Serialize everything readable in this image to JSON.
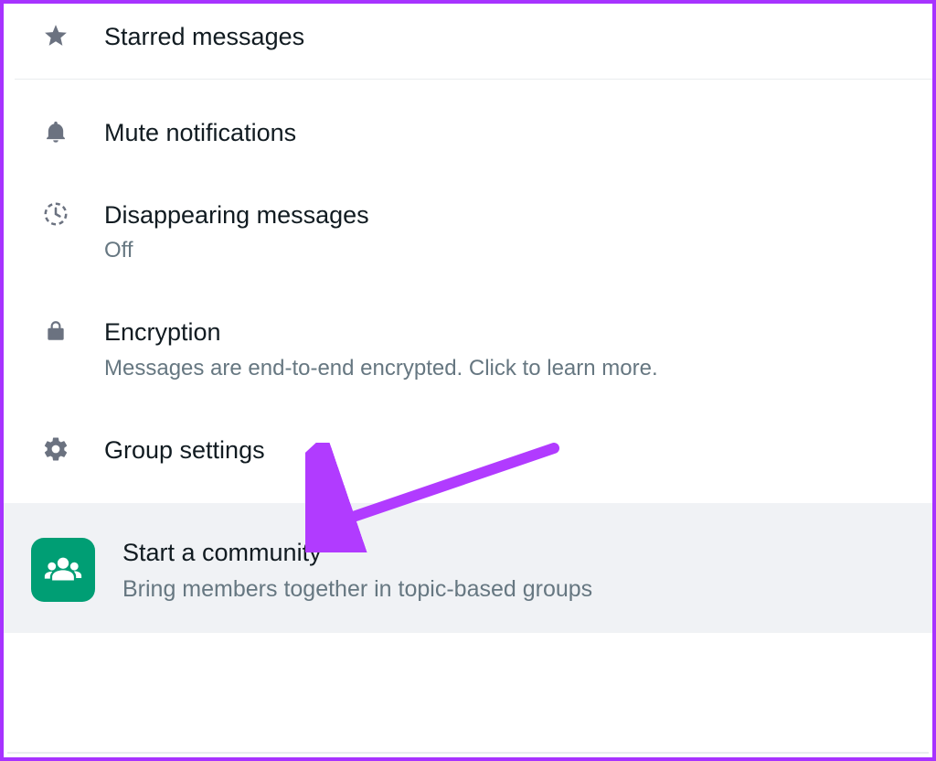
{
  "colors": {
    "frame_border": "#a733ff",
    "icon_muted": "#6b7280",
    "text_primary": "#111b21",
    "text_secondary": "#667781",
    "community_accent": "#009e74",
    "annotation_arrow": "#b13bff"
  },
  "rows": {
    "starred": {
      "label": "Starred messages",
      "icon": "star-icon"
    },
    "mute": {
      "label": "Mute notifications",
      "icon": "bell-icon"
    },
    "disappearing": {
      "label": "Disappearing messages",
      "value": "Off",
      "icon": "timer-icon"
    },
    "encryption": {
      "label": "Encryption",
      "description": "Messages are end-to-end encrypted. Click to learn more.",
      "icon": "lock-icon"
    },
    "group_settings": {
      "label": "Group settings",
      "icon": "gear-icon"
    }
  },
  "community": {
    "title": "Start a community",
    "subtitle": "Bring members together in topic-based groups",
    "icon": "people-icon"
  },
  "annotation": {
    "target": "group_settings",
    "shape": "arrow"
  }
}
